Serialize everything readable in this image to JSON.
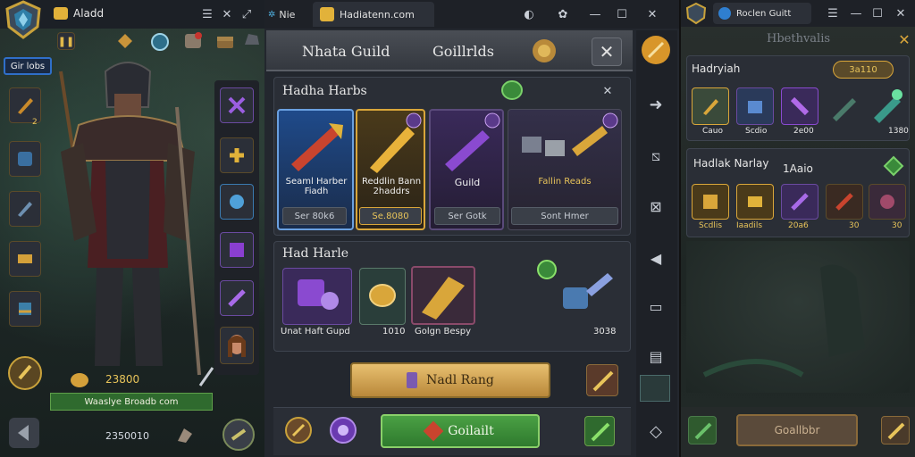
{
  "left": {
    "title": "Aladd",
    "tag": "Gir lobs",
    "item_count": "2",
    "gold": "23800",
    "player_bar": "Waaslye Broadb com",
    "bottom_value": "2350010"
  },
  "browser": {
    "tab1_title": "Nie",
    "tab2_title": "Hadiatenn.com"
  },
  "middle": {
    "header_left": "Nhata Guild",
    "header_right": "Goillrlds",
    "section1_title": "Hadha Harbs",
    "cards": [
      {
        "name": "Seaml Harber Fiadh",
        "price": "Ser 80k6"
      },
      {
        "name": "Reddlin Bann 2haddrs",
        "price": "Se.8080"
      },
      {
        "name": "Guild",
        "price": "Ser Gotk"
      },
      {
        "name": "Fallin Reads",
        "price": "Sont Hmer"
      }
    ],
    "section2_title": "Had Harle",
    "row2": {
      "label1": "Unat Haft Gupd",
      "label2": "1010",
      "label3": "Golgn Bespy",
      "value": "3038"
    },
    "button_main": "Nadl Rang",
    "button_bottom": "Goilailt"
  },
  "right": {
    "tab_title": "Roclen Guitt",
    "header": "Hbethvalis",
    "section1_title": "Hadryiah",
    "badge": "3a110",
    "row1_labels": [
      "Cauo",
      "Scdio",
      "2e00",
      "",
      "1380"
    ],
    "section2_title": "Hadlak Narlay",
    "section2_value": "1Aaio",
    "row2_labels": [
      "Scdlis",
      "Iaadils",
      "20a6",
      "30",
      "30"
    ],
    "bottom_button": "Goallbbr"
  },
  "colors": {
    "gold_accent": "#d9a63a",
    "green_button": "#3f8f3a",
    "panel": "#2a2e36",
    "tab_bar": "#1e2127"
  }
}
